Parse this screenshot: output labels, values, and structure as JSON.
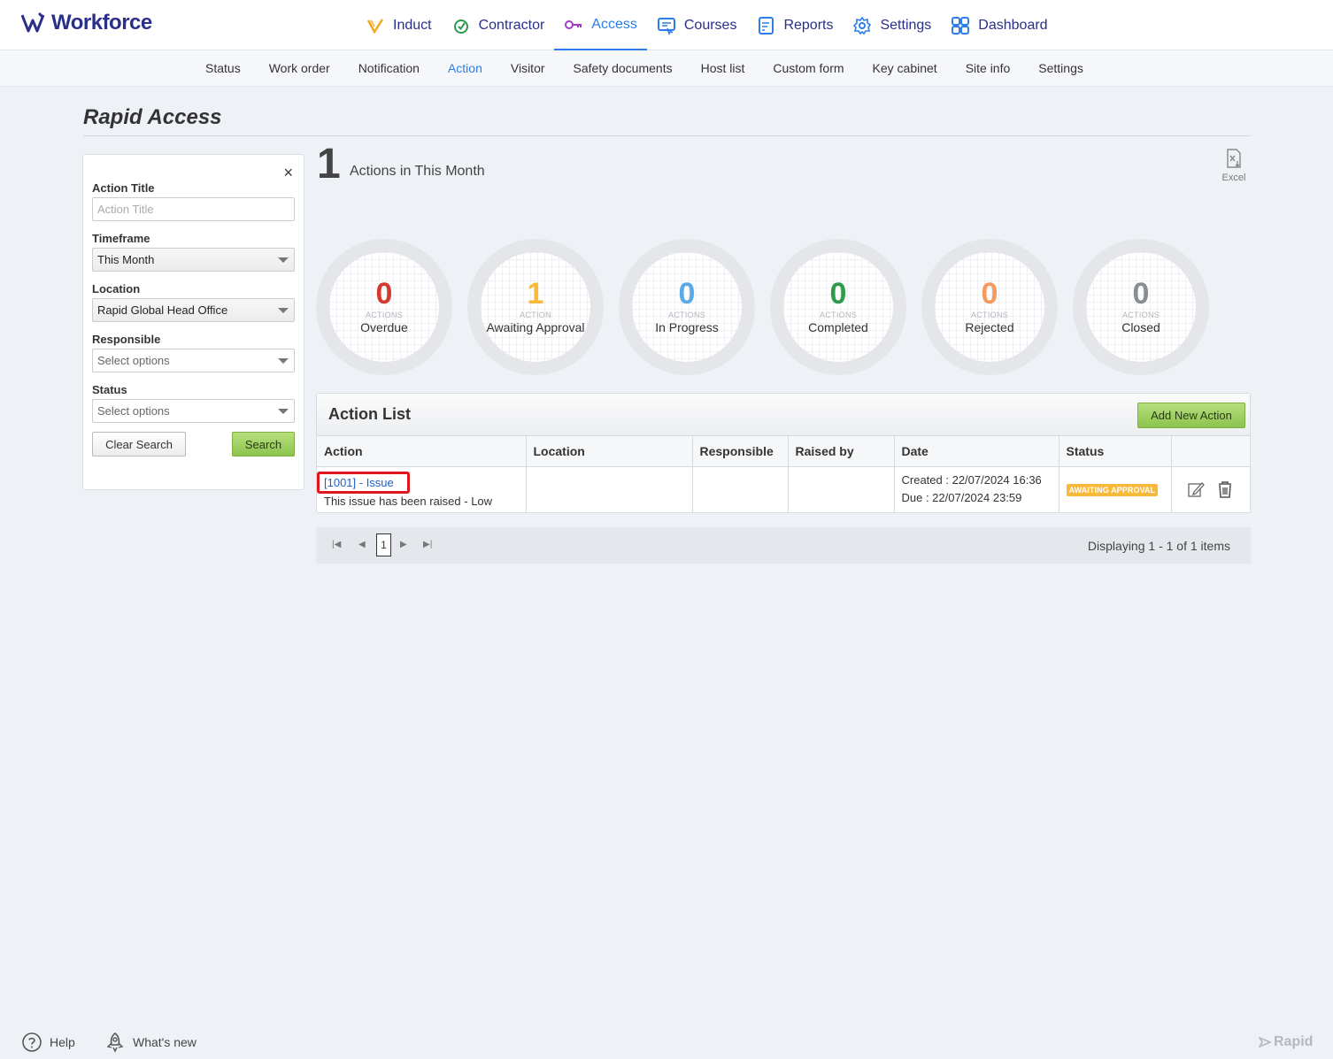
{
  "app": {
    "brand": "Workforce"
  },
  "main_nav": [
    {
      "label": "Induct",
      "icon": "induct-icon",
      "color": "#f0a818"
    },
    {
      "label": "Contractor",
      "icon": "contractor-icon",
      "color": "#2e9a4c"
    },
    {
      "label": "Access",
      "icon": "key-icon",
      "color": "#a040c0",
      "active": true
    },
    {
      "label": "Courses",
      "icon": "courses-icon",
      "color": "#2b7de9"
    },
    {
      "label": "Reports",
      "icon": "reports-icon",
      "color": "#2b7de9"
    },
    {
      "label": "Settings",
      "icon": "gear-icon",
      "color": "#2b7de9"
    },
    {
      "label": "Dashboard",
      "icon": "dashboard-icon",
      "color": "#2b7de9"
    }
  ],
  "sub_nav": [
    {
      "label": "Status"
    },
    {
      "label": "Work order"
    },
    {
      "label": "Notification"
    },
    {
      "label": "Action",
      "active": true
    },
    {
      "label": "Visitor"
    },
    {
      "label": "Safety documents"
    },
    {
      "label": "Host list"
    },
    {
      "label": "Custom form"
    },
    {
      "label": "Key cabinet"
    },
    {
      "label": "Site info"
    },
    {
      "label": "Settings"
    }
  ],
  "page": {
    "title": "Rapid Access"
  },
  "filter": {
    "close": "×",
    "action_title_label": "Action Title",
    "action_title_placeholder": "Action Title",
    "timeframe_label": "Timeframe",
    "timeframe_value": "This Month",
    "location_label": "Location",
    "location_value": "Rapid Global Head Office",
    "responsible_label": "Responsible",
    "responsible_value": "Select options",
    "status_label": "Status",
    "status_value": "Select options",
    "clear_label": "Clear Search",
    "search_label": "Search"
  },
  "summary": {
    "count": "1",
    "label": "Actions in This Month",
    "excel_label": "Excel"
  },
  "gauges": [
    {
      "value": "0",
      "sub": "ACTIONS",
      "label": "Overdue",
      "color": "#d63a2f"
    },
    {
      "value": "1",
      "sub": "ACTION",
      "label": "Awaiting Approval",
      "color": "#f8b83a"
    },
    {
      "value": "0",
      "sub": "ACTIONS",
      "label": "In Progress",
      "color": "#5aa9e6"
    },
    {
      "value": "0",
      "sub": "ACTIONS",
      "label": "Completed",
      "color": "#2e9a4c"
    },
    {
      "value": "0",
      "sub": "ACTIONS",
      "label": "Rejected",
      "color": "#f49a5e"
    },
    {
      "value": "0",
      "sub": "ACTIONS",
      "label": "Closed",
      "color": "#8a8d92"
    }
  ],
  "action_list": {
    "title": "Action List",
    "add_label": "Add New Action",
    "columns": [
      "Action",
      "Location",
      "Responsible",
      "Raised by",
      "Date",
      "Status"
    ],
    "rows": [
      {
        "link": "[1001] - Issue",
        "desc": "This issue has been raised - Low",
        "location": "",
        "responsible": "",
        "raised_by": "",
        "created": "Created : 22/07/2024 16:36",
        "due": "Due : 22/07/2024 23:59",
        "status": "AWAITING APPROVAL"
      }
    ]
  },
  "pager": {
    "first": "|◀",
    "prev": "◀",
    "current": "1",
    "next": "▶",
    "last": "▶|",
    "info": "Displaying 1 - 1 of 1 items"
  },
  "footer": {
    "help": "Help",
    "whats_new": "What's new",
    "brand": "Rapid"
  }
}
